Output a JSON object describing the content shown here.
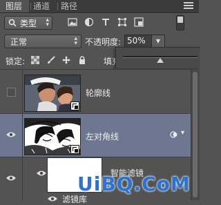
{
  "tabs": [
    {
      "label": "图层",
      "active": true
    },
    {
      "label": "通道",
      "active": false
    },
    {
      "label": "路径",
      "active": false
    }
  ],
  "filter": {
    "kind_label": "类型",
    "icons": [
      "image-filter-icon",
      "adjustment-filter-icon",
      "type-filter-icon",
      "shape-filter-icon",
      "smart-object-filter-icon"
    ]
  },
  "blend_mode": "正常",
  "opacity": {
    "label": "不透明度:",
    "value": "50%",
    "slider_fraction": 0.5
  },
  "lock": {
    "label": "锁定:",
    "icons": [
      "lock-transparent-pixels-icon",
      "lock-image-pixels-icon",
      "lock-position-icon",
      "lock-all-icon"
    ]
  },
  "fill_label": "填充",
  "layers": [
    {
      "name": "轮廓线",
      "visible": false,
      "selected": false,
      "type": "smart-object"
    },
    {
      "name": "左对角线",
      "visible": true,
      "selected": true,
      "type": "smart-object"
    }
  ],
  "smart_filters": {
    "label": "智能滤镜",
    "visible": true,
    "item_label": "滤镜库"
  },
  "watermark": "UiBQ.CoM",
  "colors": {
    "panel_bg": "#535353",
    "selected_row": "#6d7890",
    "watermark_blue": "#2a73d6"
  }
}
